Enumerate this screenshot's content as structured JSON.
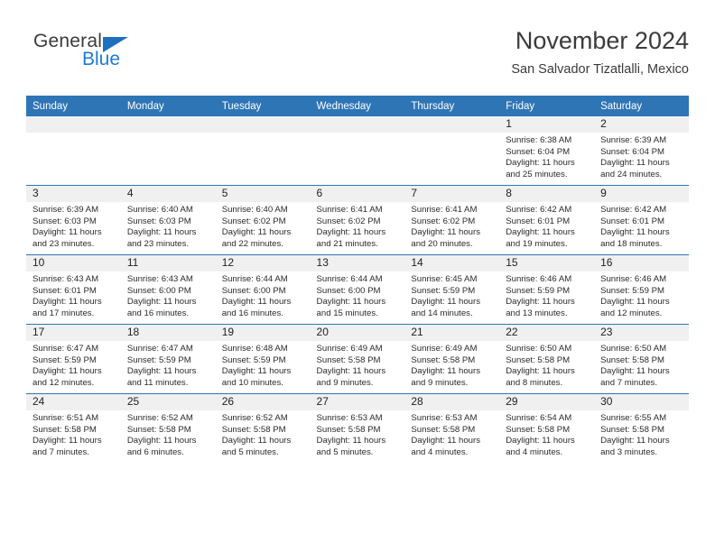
{
  "brand": {
    "name_top": "General",
    "name_bottom": "Blue",
    "triangle_icon": "blue-triangle-icon",
    "color_top": "#3b3b3b",
    "color_bottom": "#1f7ad4"
  },
  "header": {
    "title": "November 2024",
    "subtitle": "San Salvador Tizatlalli, Mexico"
  },
  "theme": {
    "header_bg": "#2e75b6",
    "header_text": "#ffffff",
    "daynum_bg": "#f0f0f0",
    "cell_bg": "#ffffff",
    "row_border": "#2e75b6",
    "body_text": "#2b2b2b"
  },
  "calendar": {
    "weekday_headers": [
      "Sunday",
      "Monday",
      "Tuesday",
      "Wednesday",
      "Thursday",
      "Friday",
      "Saturday"
    ],
    "weeks": [
      [
        {
          "day": "",
          "sunrise": "",
          "sunset": "",
          "daylight": ""
        },
        {
          "day": "",
          "sunrise": "",
          "sunset": "",
          "daylight": ""
        },
        {
          "day": "",
          "sunrise": "",
          "sunset": "",
          "daylight": ""
        },
        {
          "day": "",
          "sunrise": "",
          "sunset": "",
          "daylight": ""
        },
        {
          "day": "",
          "sunrise": "",
          "sunset": "",
          "daylight": ""
        },
        {
          "day": "1",
          "sunrise": "Sunrise: 6:38 AM",
          "sunset": "Sunset: 6:04 PM",
          "daylight": "Daylight: 11 hours and 25 minutes."
        },
        {
          "day": "2",
          "sunrise": "Sunrise: 6:39 AM",
          "sunset": "Sunset: 6:04 PM",
          "daylight": "Daylight: 11 hours and 24 minutes."
        }
      ],
      [
        {
          "day": "3",
          "sunrise": "Sunrise: 6:39 AM",
          "sunset": "Sunset: 6:03 PM",
          "daylight": "Daylight: 11 hours and 23 minutes."
        },
        {
          "day": "4",
          "sunrise": "Sunrise: 6:40 AM",
          "sunset": "Sunset: 6:03 PM",
          "daylight": "Daylight: 11 hours and 23 minutes."
        },
        {
          "day": "5",
          "sunrise": "Sunrise: 6:40 AM",
          "sunset": "Sunset: 6:02 PM",
          "daylight": "Daylight: 11 hours and 22 minutes."
        },
        {
          "day": "6",
          "sunrise": "Sunrise: 6:41 AM",
          "sunset": "Sunset: 6:02 PM",
          "daylight": "Daylight: 11 hours and 21 minutes."
        },
        {
          "day": "7",
          "sunrise": "Sunrise: 6:41 AM",
          "sunset": "Sunset: 6:02 PM",
          "daylight": "Daylight: 11 hours and 20 minutes."
        },
        {
          "day": "8",
          "sunrise": "Sunrise: 6:42 AM",
          "sunset": "Sunset: 6:01 PM",
          "daylight": "Daylight: 11 hours and 19 minutes."
        },
        {
          "day": "9",
          "sunrise": "Sunrise: 6:42 AM",
          "sunset": "Sunset: 6:01 PM",
          "daylight": "Daylight: 11 hours and 18 minutes."
        }
      ],
      [
        {
          "day": "10",
          "sunrise": "Sunrise: 6:43 AM",
          "sunset": "Sunset: 6:01 PM",
          "daylight": "Daylight: 11 hours and 17 minutes."
        },
        {
          "day": "11",
          "sunrise": "Sunrise: 6:43 AM",
          "sunset": "Sunset: 6:00 PM",
          "daylight": "Daylight: 11 hours and 16 minutes."
        },
        {
          "day": "12",
          "sunrise": "Sunrise: 6:44 AM",
          "sunset": "Sunset: 6:00 PM",
          "daylight": "Daylight: 11 hours and 16 minutes."
        },
        {
          "day": "13",
          "sunrise": "Sunrise: 6:44 AM",
          "sunset": "Sunset: 6:00 PM",
          "daylight": "Daylight: 11 hours and 15 minutes."
        },
        {
          "day": "14",
          "sunrise": "Sunrise: 6:45 AM",
          "sunset": "Sunset: 5:59 PM",
          "daylight": "Daylight: 11 hours and 14 minutes."
        },
        {
          "day": "15",
          "sunrise": "Sunrise: 6:46 AM",
          "sunset": "Sunset: 5:59 PM",
          "daylight": "Daylight: 11 hours and 13 minutes."
        },
        {
          "day": "16",
          "sunrise": "Sunrise: 6:46 AM",
          "sunset": "Sunset: 5:59 PM",
          "daylight": "Daylight: 11 hours and 12 minutes."
        }
      ],
      [
        {
          "day": "17",
          "sunrise": "Sunrise: 6:47 AM",
          "sunset": "Sunset: 5:59 PM",
          "daylight": "Daylight: 11 hours and 12 minutes."
        },
        {
          "day": "18",
          "sunrise": "Sunrise: 6:47 AM",
          "sunset": "Sunset: 5:59 PM",
          "daylight": "Daylight: 11 hours and 11 minutes."
        },
        {
          "day": "19",
          "sunrise": "Sunrise: 6:48 AM",
          "sunset": "Sunset: 5:59 PM",
          "daylight": "Daylight: 11 hours and 10 minutes."
        },
        {
          "day": "20",
          "sunrise": "Sunrise: 6:49 AM",
          "sunset": "Sunset: 5:58 PM",
          "daylight": "Daylight: 11 hours and 9 minutes."
        },
        {
          "day": "21",
          "sunrise": "Sunrise: 6:49 AM",
          "sunset": "Sunset: 5:58 PM",
          "daylight": "Daylight: 11 hours and 9 minutes."
        },
        {
          "day": "22",
          "sunrise": "Sunrise: 6:50 AM",
          "sunset": "Sunset: 5:58 PM",
          "daylight": "Daylight: 11 hours and 8 minutes."
        },
        {
          "day": "23",
          "sunrise": "Sunrise: 6:50 AM",
          "sunset": "Sunset: 5:58 PM",
          "daylight": "Daylight: 11 hours and 7 minutes."
        }
      ],
      [
        {
          "day": "24",
          "sunrise": "Sunrise: 6:51 AM",
          "sunset": "Sunset: 5:58 PM",
          "daylight": "Daylight: 11 hours and 7 minutes."
        },
        {
          "day": "25",
          "sunrise": "Sunrise: 6:52 AM",
          "sunset": "Sunset: 5:58 PM",
          "daylight": "Daylight: 11 hours and 6 minutes."
        },
        {
          "day": "26",
          "sunrise": "Sunrise: 6:52 AM",
          "sunset": "Sunset: 5:58 PM",
          "daylight": "Daylight: 11 hours and 5 minutes."
        },
        {
          "day": "27",
          "sunrise": "Sunrise: 6:53 AM",
          "sunset": "Sunset: 5:58 PM",
          "daylight": "Daylight: 11 hours and 5 minutes."
        },
        {
          "day": "28",
          "sunrise": "Sunrise: 6:53 AM",
          "sunset": "Sunset: 5:58 PM",
          "daylight": "Daylight: 11 hours and 4 minutes."
        },
        {
          "day": "29",
          "sunrise": "Sunrise: 6:54 AM",
          "sunset": "Sunset: 5:58 PM",
          "daylight": "Daylight: 11 hours and 4 minutes."
        },
        {
          "day": "30",
          "sunrise": "Sunrise: 6:55 AM",
          "sunset": "Sunset: 5:58 PM",
          "daylight": "Daylight: 11 hours and 3 minutes."
        }
      ]
    ]
  }
}
